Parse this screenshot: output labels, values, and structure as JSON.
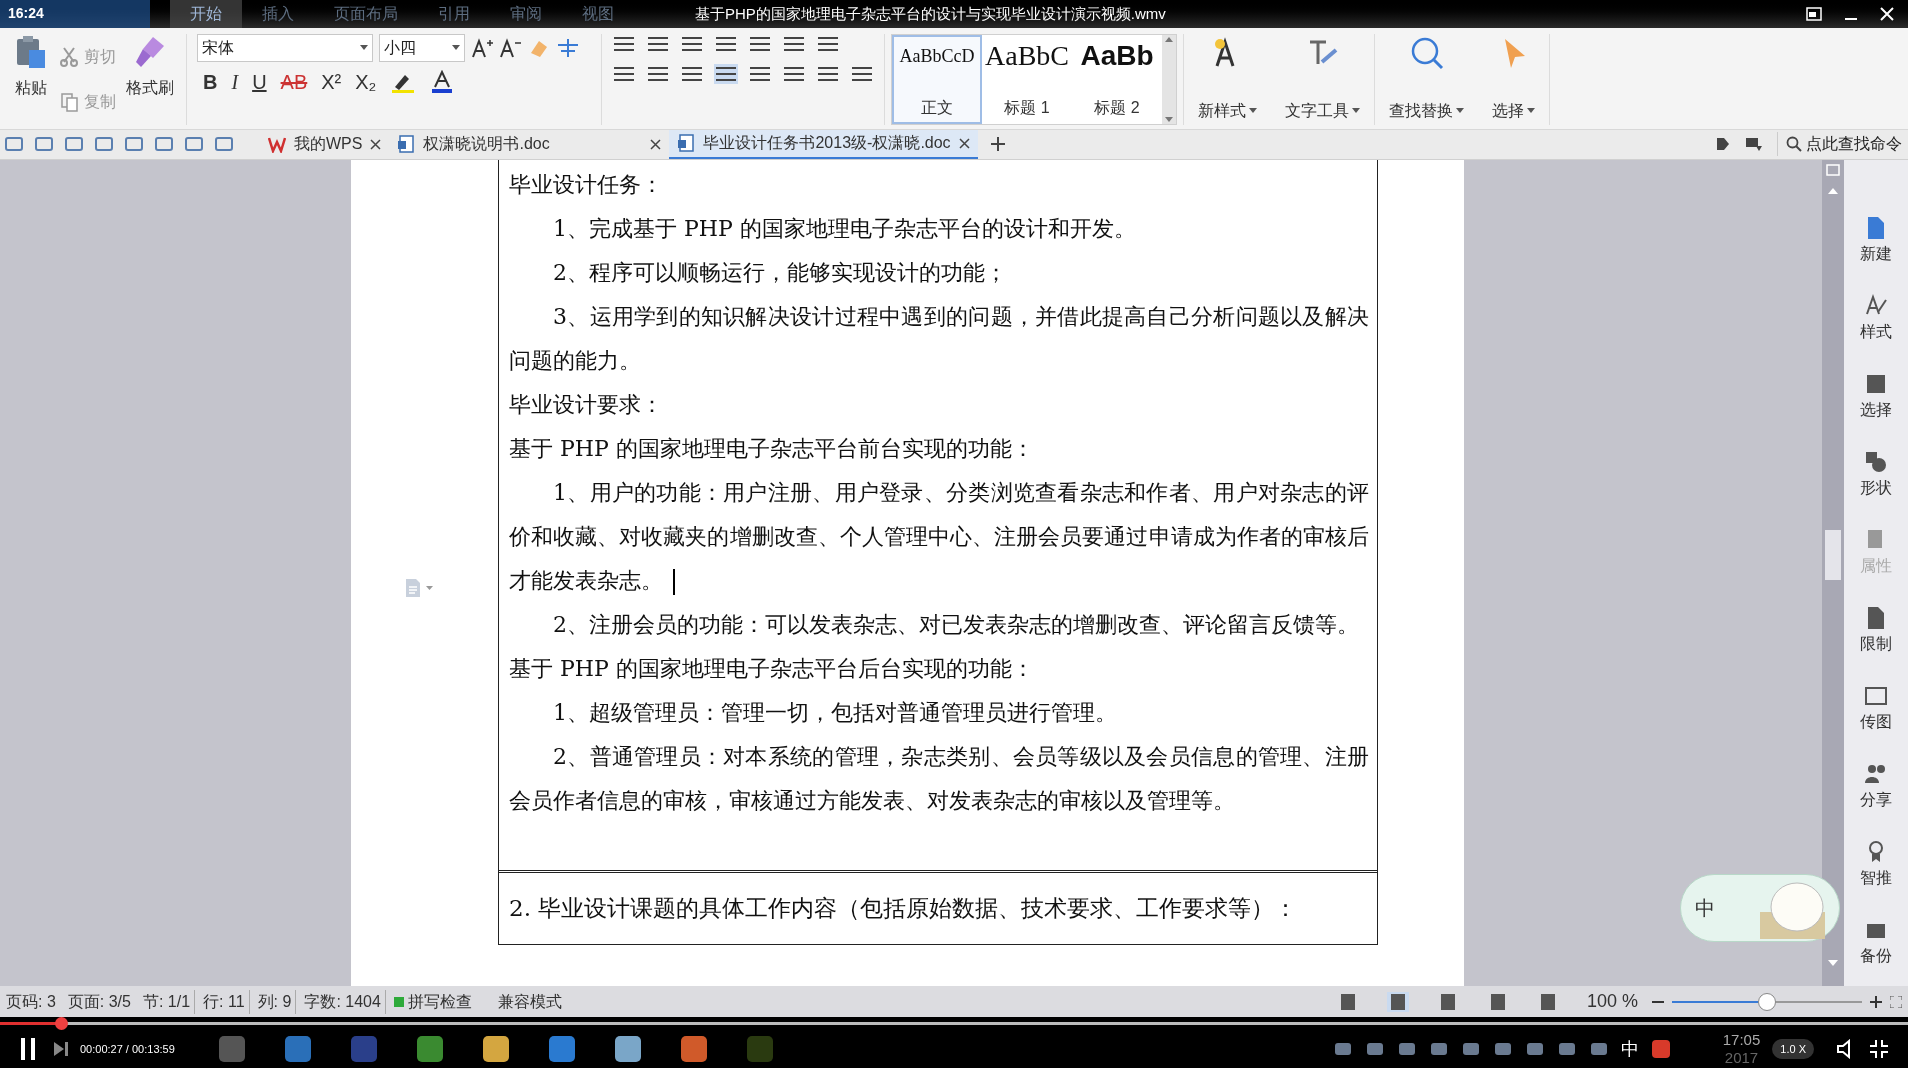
{
  "player": {
    "clock": "16:24",
    "title": "基于PHP的国家地理电子杂志平台的设计与实现毕业设计演示视频.wmv",
    "time": "00:00:27 / 00:13:59",
    "progress": {
      "level": 0.032
    },
    "speed": "1.0 X"
  },
  "ribbon_tabs": [
    {
      "label": "开始",
      "selected": true
    },
    {
      "label": "插入",
      "selected": false
    },
    {
      "label": "页面布局",
      "selected": false
    },
    {
      "label": "引用",
      "selected": false
    },
    {
      "label": "审阅",
      "selected": false
    },
    {
      "label": "视图",
      "selected": false
    }
  ],
  "ribbon": {
    "paste": "粘贴",
    "cut": "剪切",
    "copy": "复制",
    "format_painter": "格式刷",
    "font": "宋体",
    "size": "小四",
    "format_buttons": [
      "B",
      "I",
      "U",
      "AB",
      "X²",
      "X₂"
    ],
    "styles": [
      {
        "sample": "AaBbCcD",
        "label": "正文",
        "selected": true
      },
      {
        "sample": "AaBbC",
        "label": "标题 1",
        "selected": false
      },
      {
        "sample": "AaBb",
        "label": "标题 2",
        "selected": false
      }
    ],
    "tools": [
      "新样式",
      "文字工具",
      "查找替换",
      "选择"
    ]
  },
  "doc_tabs": [
    {
      "label": "我的WPS",
      "selected": false
    },
    {
      "label": "权潇晓说明书.doc",
      "selected": false
    },
    {
      "label": "毕业设计任务书2013级-权潇晓.doc",
      "selected": true
    }
  ],
  "command_search": "点此查找命令",
  "document": {
    "paragraphs": [
      {
        "text": "毕业设计任务：",
        "indent": false,
        "caret": false
      },
      {
        "text": "1、完成基于 PHP 的国家地理电子杂志平台的设计和开发。",
        "indent": true,
        "caret": false
      },
      {
        "text": "2、程序可以顺畅运行，能够实现设计的功能；",
        "indent": true,
        "caret": false
      },
      {
        "text": "3、运用学到的知识解决设计过程中遇到的问题，并借此提高自己分析问题以及解决问题的能力。",
        "indent": true,
        "caret": false
      },
      {
        "text": "毕业设计要求：",
        "indent": false,
        "caret": false
      },
      {
        "text": "基于 PHP 的国家地理电子杂志平台前台实现的功能：",
        "indent": false,
        "caret": false
      },
      {
        "text": "1、用户的功能：用户注册、用户登录、分类浏览查看杂志和作者、用户对杂志的评价和收藏、对收藏夹的增删改查、个人管理中心、注册会员要通过申请成为作者的审核后才能发表杂志。",
        "indent": true,
        "caret": true
      },
      {
        "text": "2、注册会员的功能：可以发表杂志、对已发表杂志的增删改查、评论留言反馈等。",
        "indent": true,
        "caret": false
      },
      {
        "text": "基于 PHP 的国家地理电子杂志平台后台实现的功能：",
        "indent": false,
        "caret": false
      },
      {
        "text": "1、超级管理员：管理一切，包括对普通管理员进行管理。",
        "indent": true,
        "caret": false
      },
      {
        "text": "2、普通管理员：对本系统的管理，杂志类别、会员等级以及会员信息的管理、注册会员作者信息的审核，审核通过方能发表、对发表杂志的审核以及管理等。",
        "indent": true,
        "caret": false
      }
    ],
    "next_heading": "2. 毕业设计课题的具体工作内容（包括原始数据、技术要求、工作要求等）："
  },
  "sidebar": [
    "新建",
    "样式",
    "选择",
    "形状",
    "属性",
    "限制",
    "传图",
    "分享",
    "智推",
    "备份"
  ],
  "status": {
    "items": [
      "页码: 3",
      "页面: 3/5",
      "节: 1/1",
      "行: 11",
      "列: 9",
      "字数: 1404"
    ],
    "spell_check": "拼写检查",
    "mode": "兼容模式",
    "zoom": "100 %",
    "zoom_slider": {
      "level": 0.5
    }
  },
  "taskbar": {
    "ime": "中",
    "tray_ime": "中",
    "clock": "17:05",
    "date": "2017"
  }
}
